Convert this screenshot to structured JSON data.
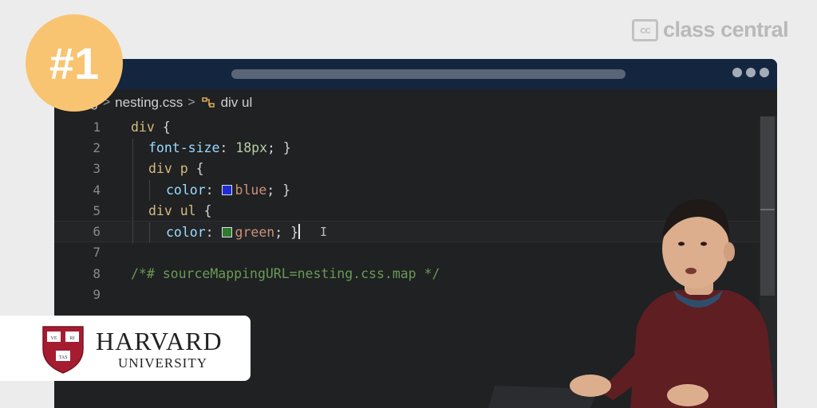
{
  "brand": {
    "logo_box": "cc",
    "logo_text": "class central"
  },
  "rank_badge": "#1",
  "editor": {
    "breadcrumb": {
      "folder": "nesting",
      "file": "nesting.css",
      "symbol": "div ul",
      "sep": ">"
    },
    "lines": [
      {
        "n": "1",
        "tokens": {
          "a": "div",
          "b": " {"
        }
      },
      {
        "n": "2",
        "tokens": {
          "prop": "font-size",
          "colon": ": ",
          "num": "18px",
          "end": "; }"
        }
      },
      {
        "n": "3",
        "tokens": {
          "a": "div p",
          "b": " {"
        }
      },
      {
        "n": "4",
        "tokens": {
          "prop": "color",
          "colon": ": ",
          "val": "blue",
          "end": "; }",
          "swatch": "#1f2bd6"
        }
      },
      {
        "n": "5",
        "tokens": {
          "a": "div ul",
          "b": " {"
        }
      },
      {
        "n": "6",
        "tokens": {
          "prop": "color",
          "colon": ": ",
          "val": "green",
          "end": "; }",
          "swatch": "#2f7a2f"
        }
      },
      {
        "n": "7"
      },
      {
        "n": "8",
        "tokens": {
          "comment": "/*# sourceMappingURL=nesting.css.map */"
        }
      },
      {
        "n": "9"
      }
    ]
  },
  "university": {
    "name": "HARVARD",
    "subtitle": "UNIVERSITY",
    "shield_letters": [
      "VE",
      "RI",
      "TAS"
    ]
  },
  "colors": {
    "badge": "#f8c471",
    "window_bar": "#14253f",
    "editor_bg": "#1f2123",
    "shield_red": "#a51c30"
  }
}
